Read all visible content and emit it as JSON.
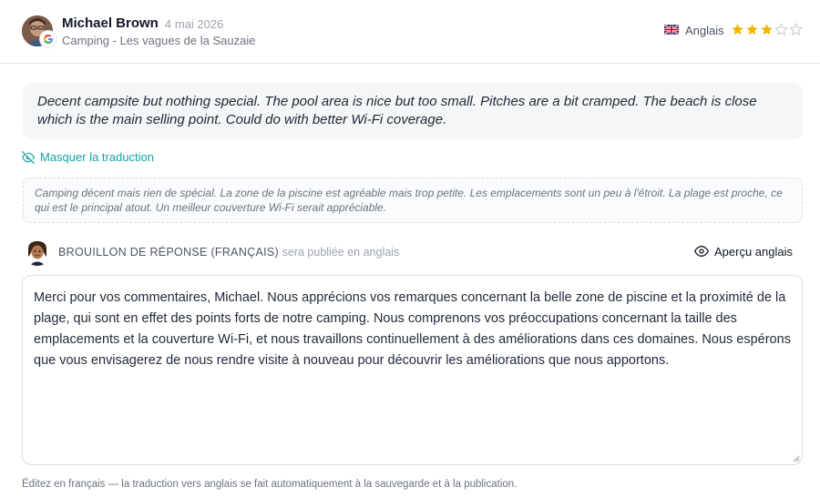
{
  "review": {
    "reviewer_name": "Michael Brown",
    "date": "4 mai 2026",
    "location": "Camping - Les vagues de la Sauzaie",
    "source_icon": "google-icon",
    "language_label": "Anglais",
    "rating": 3,
    "rating_max": 5,
    "original_text": "Decent campsite but nothing special. The pool area is nice but too small. Pitches are a bit cramped. The beach is close which is the main selling point. Could do with better Wi-Fi coverage.",
    "toggle_translation_label": "Masquer la traduction",
    "translation_text": "Camping décent mais rien de spécial. La zone de la piscine est agréable mais trop petite. Les emplacements sont un peu à l'étroit. La plage est proche, ce qui est le principal atout. Un meilleur couverture Wi-Fi serait appréciable."
  },
  "draft": {
    "title": "BROUILLON DE RÉPONSE (FRANÇAIS)",
    "subtitle": "· sera publiée en anglais",
    "preview_label": "Aperçu anglais",
    "reply_text": "Merci pour vos commentaires, Michael. Nous apprécions vos remarques concernant la belle zone de piscine et la proximité de la plage, qui sont en effet des points forts de notre camping. Nous comprenons vos préoccupations concernant la taille des emplacements et la couverture Wi-Fi, et nous travaillons continuellement à des améliorations dans ces domaines. Nous espérons que vous envisagerez de nous rendre visite à nouveau pour découvrir les améliorations que nous apportons.",
    "footer_note": "Éditez en français — la traduction vers anglais se fait automatiquement à la sauvegarde et à la publication."
  },
  "colors": {
    "accent": "#14a3a3",
    "star_filled": "#f5b301",
    "star_empty": "#c7cbd1"
  }
}
